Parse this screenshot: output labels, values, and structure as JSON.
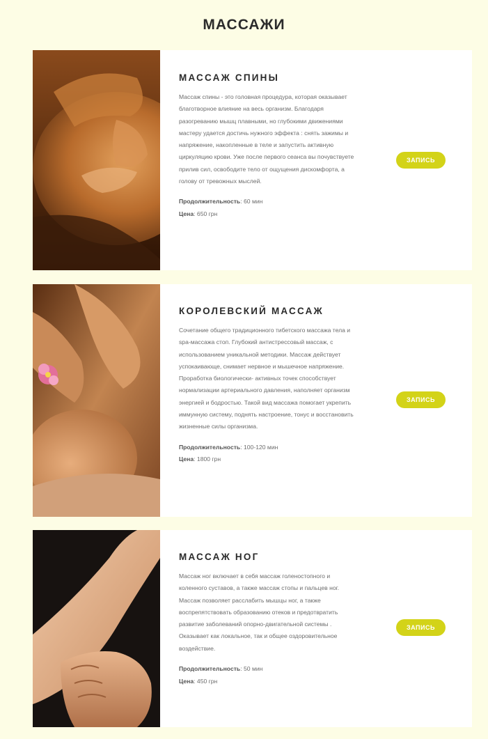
{
  "page": {
    "title": "МАССАЖИ"
  },
  "labels": {
    "duration": "Продолжительность",
    "price": "Цена"
  },
  "colors": {
    "background": "#fdfde5",
    "card": "#ffffff",
    "button": "#d3d318"
  },
  "massages": [
    {
      "title": "МАССАЖ СПИНЫ",
      "description": "Массаж спины - это головная процедура, которая оказывает благотворное влияние на весь организм. Благодаря разогреванию мышц плавными, но глубокими движениями мастеру удается достичь нужного эффекта : снять зажимы и напряжение, накопленные в теле и запустить активную циркуляцию крови. Уже после первого сеанса вы почувствуете прилив сил, освободите тело от ощущения дискомфорта, а голову от тревожных мыслей.",
      "duration": "60 мин",
      "price": "650 грн",
      "button": "ЗАПИСЬ"
    },
    {
      "title": "КОРОЛЕВСКИЙ МАССАЖ",
      "description": "Сочетание общего традиционного тибетского массажа тела и spa-массажа стоп. Глубокий антистрессовый массаж, с использованием уникальной методики. Массаж действует успокаивающе, снимает нервное и мышечное напряжение. Проработка биологически- активных точек способствует нормализации артериального давления, наполняет организм энергией и бодростью. Такой вид массажа помогает укрепить иммунную систему, поднять настроение, тонус и восстановить жизненные силы организма.",
      "duration": "100-120 мин",
      "price": "1800 грн",
      "button": "ЗАПИСЬ"
    },
    {
      "title": "МАССАЖ НОГ",
      "description": "Массаж ног включает в себя массаж голеностопного и коленного суставов, а также массаж стопы и пальцев ног. Массаж позволяет расслабить мышцы ног, а также воспрепятствовать образованию отеков и предотвратить развитие заболеваний опорно-двигательной системы . Оказывает как локальное, так и общее оздоровительное воздействие.",
      "duration": "50 мин",
      "price": "450 грн",
      "button": "ЗАПИСЬ"
    }
  ]
}
